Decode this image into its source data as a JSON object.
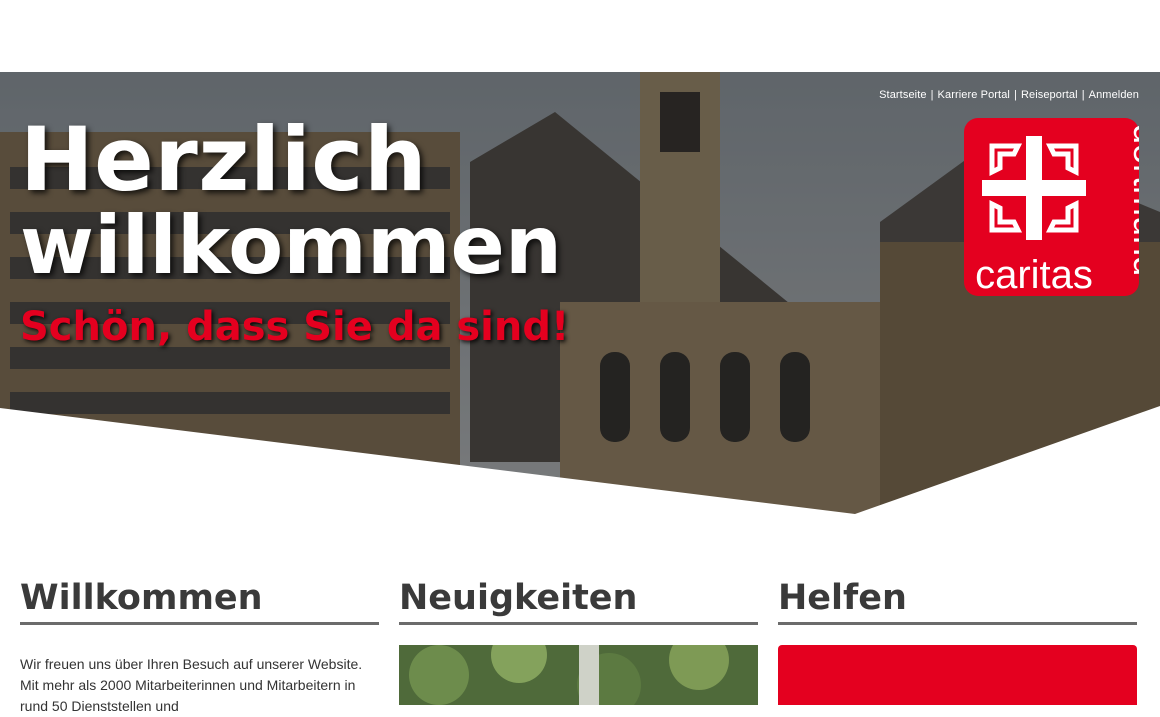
{
  "topnav": {
    "links": [
      "Startseite",
      "Karriere Portal",
      "Reiseportal",
      "Anmelden"
    ],
    "separator": "|"
  },
  "hero": {
    "title_line1": "Herzlich",
    "title_line2": "willkommen",
    "subtitle": "Schön, dass Sie da sind!"
  },
  "logo": {
    "name": "caritas",
    "city": "dortmund",
    "icon": "caritas-cross-icon",
    "color": "#e4001f"
  },
  "columns": {
    "welcome": {
      "heading": "Willkommen",
      "text": "Wir freuen uns über Ihren Besuch auf unserer Website. Mit mehr als 2000 Mitarbeiterinnen und Mitarbeitern in rund 50 Dienststellen und"
    },
    "news": {
      "heading": "Neuigkeiten"
    },
    "help": {
      "heading": "Helfen"
    }
  },
  "colors": {
    "accent": "#e4001f",
    "heading": "#3a3a3a"
  }
}
